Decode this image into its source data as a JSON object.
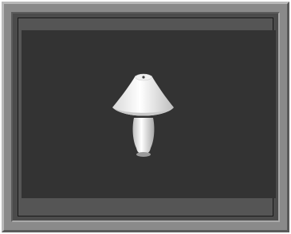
{
  "viewer": {
    "background_color": "#333333",
    "frame_color": "#8a8a8a",
    "object_icon": "table-lamp-icon"
  }
}
